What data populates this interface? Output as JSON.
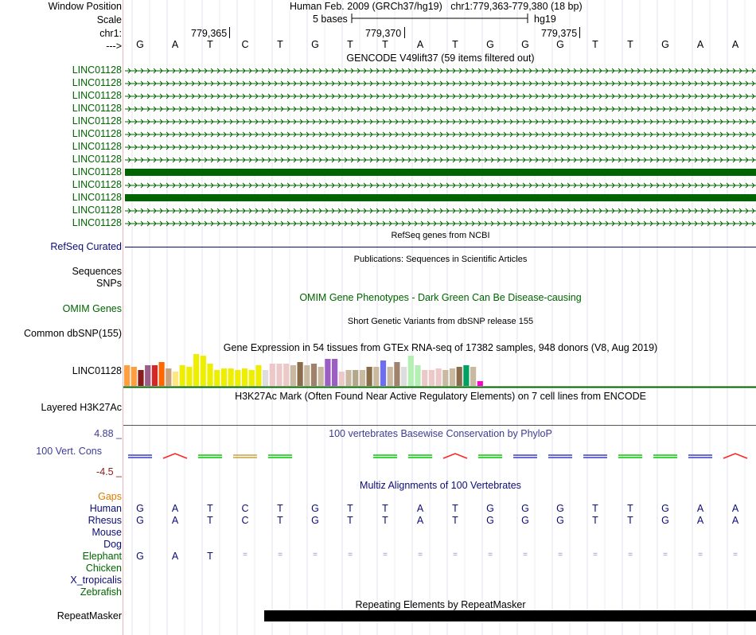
{
  "header": {
    "window_position_label": "Window Position",
    "assembly": "Human Feb. 2009 (GRCh37/hg19)",
    "position": "chr1:779,363-779,380 (18 bp)",
    "scale_label": "Scale",
    "scale_text": "5 bases",
    "scale_db": "hg19",
    "chrom_label": "chr1:",
    "ticks": [
      "779,365",
      "779,370",
      "779,375"
    ],
    "strand_label": "--->",
    "bases": [
      "G",
      "A",
      "T",
      "C",
      "T",
      "G",
      "T",
      "T",
      "A",
      "T",
      "G",
      "G",
      "G",
      "T",
      "T",
      "G",
      "A",
      "A"
    ]
  },
  "gencode": {
    "title": "GENCODE V49lift37 (59 items filtered out)",
    "rows": [
      {
        "label": "LINC01128",
        "style": "arrows"
      },
      {
        "label": "LINC01128",
        "style": "arrows"
      },
      {
        "label": "LINC01128",
        "style": "arrows"
      },
      {
        "label": "LINC01128",
        "style": "arrows"
      },
      {
        "label": "LINC01128",
        "style": "arrows"
      },
      {
        "label": "LINC01128",
        "style": "arrows"
      },
      {
        "label": "LINC01128",
        "style": "arrows"
      },
      {
        "label": "LINC01128",
        "style": "arrows"
      },
      {
        "label": "LINC01128",
        "style": "solid"
      },
      {
        "label": "LINC01128",
        "style": "arrows"
      },
      {
        "label": "LINC01128",
        "style": "solid"
      },
      {
        "label": "LINC01128",
        "style": "arrows"
      },
      {
        "label": "LINC01128",
        "style": "arrows"
      }
    ],
    "color": "#006400"
  },
  "refseq": {
    "title": "RefSeq genes from NCBI",
    "label": "RefSeq Curated",
    "color": "#0c0c78"
  },
  "publications": {
    "title": "Publications: Sequences in Scientific Articles",
    "label": "Sequences"
  },
  "snps": {
    "label": "SNPs"
  },
  "omim": {
    "title": "OMIM Gene Phenotypes - Dark Green Can Be Disease-causing",
    "label": "OMIM Genes"
  },
  "dbsnp": {
    "title": "Short Genetic Variants from dbSNP release 155",
    "label": "Common dbSNP(155)"
  },
  "gtex": {
    "title": "Gene Expression in 54 tissues from GTEx RNA-seq of 17382 samples, 948 donors (V8, Aug 2019)",
    "label": "LINC01128",
    "bars": [
      {
        "c": "#ff9e3e",
        "h": 26
      },
      {
        "c": "#ff9e3e",
        "h": 24
      },
      {
        "c": "#8b1a1a",
        "h": 20
      },
      {
        "c": "#9c5e87",
        "h": 26
      },
      {
        "c": "#d62728",
        "h": 26
      },
      {
        "c": "#ff6600",
        "h": 30
      },
      {
        "c": "#c9a27b",
        "h": 22
      },
      {
        "c": "#ffe680",
        "h": 18
      },
      {
        "c": "#eeee00",
        "h": 26
      },
      {
        "c": "#eeee00",
        "h": 24
      },
      {
        "c": "#eeee00",
        "h": 40
      },
      {
        "c": "#eeee00",
        "h": 38
      },
      {
        "c": "#eeee00",
        "h": 28
      },
      {
        "c": "#eeee00",
        "h": 20
      },
      {
        "c": "#eeee00",
        "h": 22
      },
      {
        "c": "#eeee00",
        "h": 22
      },
      {
        "c": "#eeee00",
        "h": 20
      },
      {
        "c": "#eeee00",
        "h": 22
      },
      {
        "c": "#eeee00",
        "h": 20
      },
      {
        "c": "#eeee00",
        "h": 26
      },
      {
        "c": "#dddddd",
        "h": 20
      },
      {
        "c": "#ecc8c8",
        "h": 28
      },
      {
        "c": "#ecc8c8",
        "h": 28
      },
      {
        "c": "#ecc8c8",
        "h": 28
      },
      {
        "c": "#c8b9a0",
        "h": 26
      },
      {
        "c": "#8a6c4a",
        "h": 30
      },
      {
        "c": "#c8b9a0",
        "h": 26
      },
      {
        "c": "#a0826c",
        "h": 28
      },
      {
        "c": "#c8b9a0",
        "h": 24
      },
      {
        "c": "#9c5ec4",
        "h": 34
      },
      {
        "c": "#9c5ec4",
        "h": 34
      },
      {
        "c": "#ecc8c8",
        "h": 18
      },
      {
        "c": "#c8b9a0",
        "h": 20
      },
      {
        "c": "#b4a88a",
        "h": 20
      },
      {
        "c": "#c8b9a0",
        "h": 20
      },
      {
        "c": "#8a6c4a",
        "h": 24
      },
      {
        "c": "#c8b9a0",
        "h": 24
      },
      {
        "c": "#6e6ef0",
        "h": 32
      },
      {
        "c": "#c8b9a0",
        "h": 24
      },
      {
        "c": "#a0826c",
        "h": 30
      },
      {
        "c": "#dddddd",
        "h": 24
      },
      {
        "c": "#b4f0b4",
        "h": 38
      },
      {
        "c": "#b4f0b4",
        "h": 26
      },
      {
        "c": "#ecc8c8",
        "h": 20
      },
      {
        "c": "#ecc8c8",
        "h": 20
      },
      {
        "c": "#ecc8c8",
        "h": 22
      },
      {
        "c": "#c8b9a0",
        "h": 20
      },
      {
        "c": "#c8b9a0",
        "h": 22
      },
      {
        "c": "#8a6c4a",
        "h": 24
      },
      {
        "c": "#00a060",
        "h": 26
      },
      {
        "c": "#c8b9a0",
        "h": 24
      },
      {
        "c": "#ff00cc",
        "h": 6
      }
    ]
  },
  "h3k27ac": {
    "title": "H3K27Ac Mark (Often Found Near Active Regulatory Elements) on 7 cell lines from ENCODE",
    "label": "Layered H3K27Ac"
  },
  "conservation": {
    "title": "100 vertebrates Basewise Conservation by PhyloP",
    "label": "100 Vert. Cons",
    "max": "4.88 _",
    "min": "-4.5 _",
    "color": "#3c3c96"
  },
  "multiz": {
    "title": "Multiz Alignments of 100 Vertebrates",
    "gaps_label": "Gaps",
    "species": [
      {
        "name": "Human",
        "color": "#0c0c78",
        "seq": [
          "G",
          "A",
          "T",
          "C",
          "T",
          "G",
          "T",
          "T",
          "A",
          "T",
          "G",
          "G",
          "G",
          "T",
          "T",
          "G",
          "A",
          "A"
        ]
      },
      {
        "name": "Rhesus",
        "color": "#0c0c78",
        "seq": [
          "G",
          "A",
          "T",
          "C",
          "T",
          "G",
          "T",
          "T",
          "A",
          "T",
          "G",
          "G",
          "G",
          "T",
          "T",
          "G",
          "A",
          "A"
        ]
      },
      {
        "name": "Mouse",
        "color": "#0c0c78",
        "seq": []
      },
      {
        "name": "Dog",
        "color": "#0c0c78",
        "seq": []
      },
      {
        "name": "Elephant",
        "color": "#006400",
        "seq": [
          "G",
          "A",
          "T",
          "=",
          "=",
          "=",
          "=",
          "=",
          "=",
          "=",
          "=",
          "=",
          "=",
          "=",
          "=",
          "=",
          "=",
          "="
        ]
      },
      {
        "name": "Chicken",
        "color": "#006400",
        "seq": []
      },
      {
        "name": "X_tropicalis",
        "color": "#0c0c78",
        "seq": []
      },
      {
        "name": "Zebrafish",
        "color": "#006400",
        "seq": []
      }
    ]
  },
  "repeatmasker": {
    "title": "Repeating Elements by RepeatMasker",
    "label": "RepeatMasker"
  }
}
